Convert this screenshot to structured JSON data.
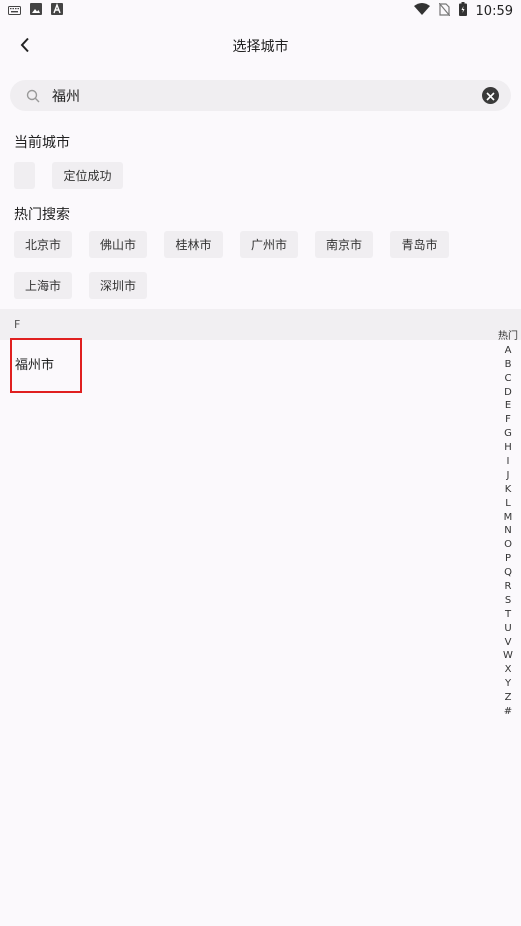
{
  "status_bar": {
    "time": "10:59",
    "left_icons": [
      "keyboard-icon",
      "image-icon",
      "a-icon"
    ],
    "right_icons": [
      "wifi-icon",
      "no-sim-icon",
      "battery-icon"
    ]
  },
  "header": {
    "title": "选择城市",
    "back_icon": "back-arrow-icon"
  },
  "search": {
    "value": "福州",
    "placeholder": "",
    "icon": "search-icon",
    "clear_icon": "clear-icon"
  },
  "current_city": {
    "title": "当前城市",
    "city_name": "",
    "location_status": "定位成功"
  },
  "hot_search": {
    "title": "热门搜索",
    "cities": [
      "北京市",
      "佛山市",
      "桂林市",
      "广州市",
      "南京市",
      "青岛市",
      "上海市",
      "深圳市"
    ]
  },
  "results": {
    "group_letter": "F",
    "items": [
      "福州市"
    ]
  },
  "index_bar": {
    "letters": [
      "热门",
      "A",
      "B",
      "C",
      "D",
      "E",
      "F",
      "G",
      "H",
      "I",
      "J",
      "K",
      "L",
      "M",
      "N",
      "O",
      "P",
      "Q",
      "R",
      "S",
      "T",
      "U",
      "V",
      "W",
      "X",
      "Y",
      "Z",
      "#"
    ]
  },
  "colors": {
    "background": "#fbf9fc",
    "chip_bg": "#f0eef1",
    "highlight_border": "#e02020"
  }
}
